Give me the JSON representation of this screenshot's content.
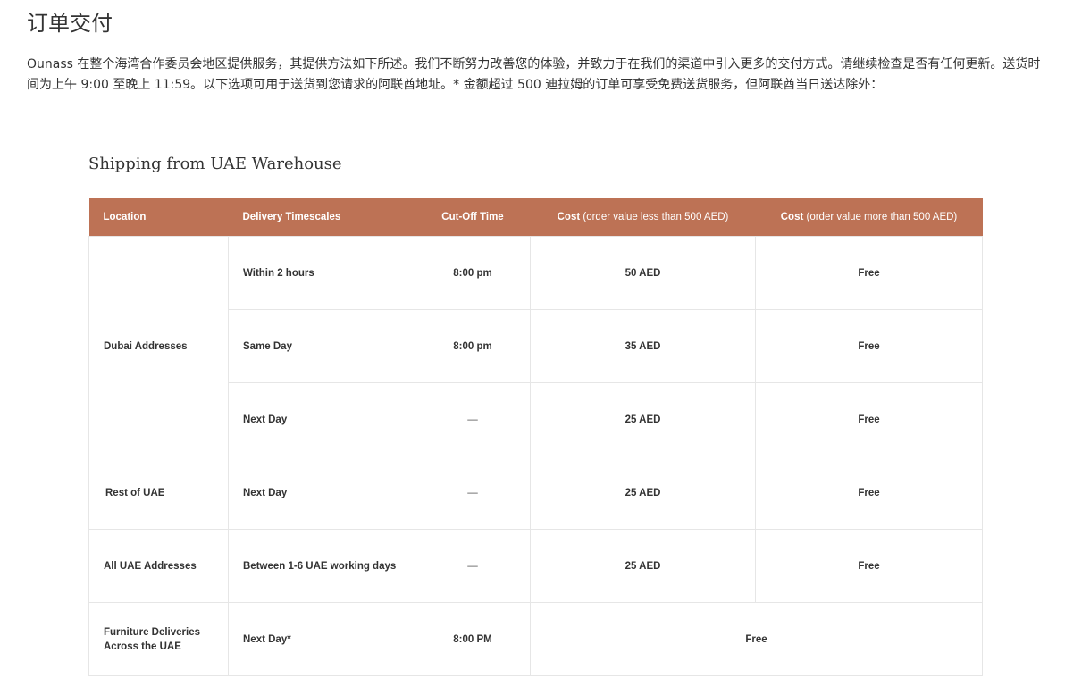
{
  "page": {
    "title": "订单交付",
    "intro": "Ounass 在整个海湾合作委员会地区提供服务，其提供方法如下所述。我们不断努力改善您的体验，并致力于在我们的渠道中引入更多的交付方式。请继续检查是否有任何更新。送货时间为上午 9:00 至晚上 11:59。以下选项可用于送货到您请求的阿联酋地址。* 金额超过 500 迪拉姆的订单可享受免费送货服务，但阿联酋当日送达除外："
  },
  "section": {
    "title": "Shipping from UAE Warehouse"
  },
  "table": {
    "header_color": "#bd7255",
    "headers": {
      "location": "Location",
      "timescales": "Delivery Timescales",
      "cutoff": "Cut-Off Time",
      "cost_low": "Cost",
      "cost_low_note": " (order value less than 500 AED)",
      "cost_high": "Cost",
      "cost_high_note": " (order value more than 500 AED)"
    },
    "rows": [
      {
        "location": "Dubai Addresses",
        "timescale": "Within 2 hours",
        "cutoff": "8:00 pm",
        "cost_low": "50 AED",
        "cost_high": "Free"
      },
      {
        "timescale": "Same Day",
        "cutoff": "8:00 pm",
        "cost_low": "35 AED",
        "cost_high": "Free"
      },
      {
        "timescale": "Next Day",
        "cutoff": "—",
        "cost_low": "25 AED",
        "cost_high": "Free"
      },
      {
        "location": "Rest of UAE",
        "timescale": "Next Day",
        "cutoff": "—",
        "cost_low": "25 AED",
        "cost_high": "Free"
      },
      {
        "location": "All UAE Addresses",
        "timescale": "Between 1-6 UAE working days",
        "cutoff": "—",
        "cost_low": "25 AED",
        "cost_high": "Free"
      },
      {
        "location_line1": "Furniture Deliveries",
        "location_line2": "Across the UAE",
        "timescale": "Next Day*",
        "cutoff": "8:00 PM",
        "cost_merged": "Free"
      }
    ]
  }
}
